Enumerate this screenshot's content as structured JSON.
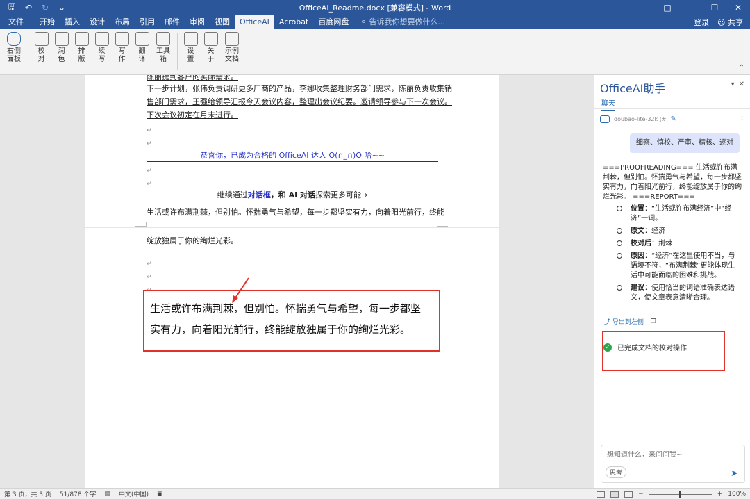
{
  "titlebar": {
    "title": "OfficeAI_Readme.docx [兼容模式] - Word",
    "quick_access": [
      "save-icon",
      "undo-icon",
      "redo-icon",
      "customize-icon"
    ]
  },
  "tabs": [
    "文件",
    "开始",
    "插入",
    "设计",
    "布局",
    "引用",
    "邮件",
    "审阅",
    "视图",
    "OfficeAI",
    "Acrobat",
    "百度网盘"
  ],
  "active_tab": "OfficeAI",
  "tell_me": "告诉我你想要做什么...",
  "account": {
    "login": "登录",
    "share": "共享"
  },
  "ribbon": {
    "buttons": [
      {
        "label": "右侧面板",
        "icon": "panel-icon"
      },
      {
        "label": "校对",
        "icon": "proofread-icon"
      },
      {
        "label": "润色",
        "icon": "polish-icon"
      },
      {
        "label": "排版",
        "icon": "layout-icon"
      },
      {
        "label": "续写",
        "icon": "continue-icon"
      },
      {
        "label": "写作",
        "icon": "write-icon"
      },
      {
        "label": "翻译",
        "icon": "translate-icon"
      },
      {
        "label": "工具箱",
        "icon": "toolbox-icon"
      },
      {
        "label": "设置",
        "icon": "settings-icon"
      },
      {
        "label": "关于",
        "icon": "about-icon"
      },
      {
        "label": "示例文档",
        "icon": "sample-doc-icon"
      }
    ]
  },
  "document": {
    "page1_lines": [
      "陈丽提到客户的实际需求。",
      "下一步计划，张伟负责调研更多厂商的产品，李娜收集整理财务部门需求，陈丽负责收集销",
      "售部门需求，王强给领导汇报今天会议内容，整理出会议纪要。邀请领导参与下一次会议。",
      "下次会议初定在月末进行。"
    ],
    "congrats": "恭喜你，已成为合格的 OfficeAI 达人 O(∩_∩)O 哈~~",
    "continue_pre": "继续通过",
    "continue_dialog": "对话框",
    "continue_mid": "，和 AI 对话",
    "continue_post": "探索更多可能→",
    "line_a": "生活或许布满荆棘，但别怕。怀揣勇气与希望，每一步都坚实有力，向着阳光前行，终能",
    "line_b": "绽放独属于你的绚烂光彩。",
    "highlight_line1": "生活或许布满荆棘，但别怕。怀揣勇气与希望，每一步都坚",
    "highlight_line2": "实有力，向着阳光前行，终能绽放独属于你的绚烂光彩。"
  },
  "pane": {
    "title": "OfficeAI助手",
    "tab": "聊天",
    "model": "doubao-lite-32k (#",
    "user_message": "细察、慎校、严审、精核、逐对",
    "response_intro": "===PROOFREADING=== 生活或许布满荆棘，但别怕。怀揣勇气与希望，每一步都坚实有力，向着阳光前行，终能绽放属于你的绚烂光彩。 ===REPORT===",
    "report": [
      {
        "key": "位置",
        "value": "：“生活或许布满经济”中“经济”一词。"
      },
      {
        "key": "原文",
        "value": "：经济"
      },
      {
        "key": "校对后",
        "value": "：荆棘"
      },
      {
        "key": "原因",
        "value": "：“经济”在这里使用不当，与语境不符，“布满荆棘”更能体现生活中可能面临的困难和挑战。"
      },
      {
        "key": "建议",
        "value": "：使用恰当的词语准确表达语义，使文章表意清晰合理。"
      }
    ],
    "export_label": "导出到左侧",
    "status_message": "已完成文档的校对操作",
    "input_placeholder": "想知道什么，来问问我~",
    "think_label": "思考"
  },
  "statusbar": {
    "page": "第 3 页，共 3 页",
    "words": "51/878 个字",
    "language": "中文(中国)",
    "zoom": "100%",
    "zoom_level": 1.0
  }
}
